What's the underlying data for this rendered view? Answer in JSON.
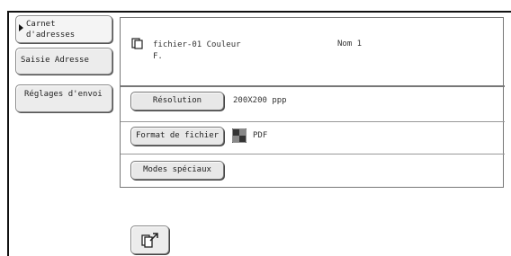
{
  "sidebar": {
    "address_book_label": "Carnet\nd'adresses",
    "address_entry_label": "Saisie Adresse",
    "send_settings_label": "Réglages d'envoi"
  },
  "destination": {
    "name": "fichier-01 Couleur\nF.",
    "label": "Nom 1",
    "icon": "document-copy-icon"
  },
  "settings": {
    "resolution_label": "Résolution",
    "resolution_value": "200X200 ppp",
    "file_format_label": "Format de fichier",
    "file_format_value": "PDF",
    "file_format_icon": "color-grid-icon",
    "special_modes_label": "Modes spéciaux"
  },
  "footer": {
    "export_icon": "document-export-icon"
  }
}
